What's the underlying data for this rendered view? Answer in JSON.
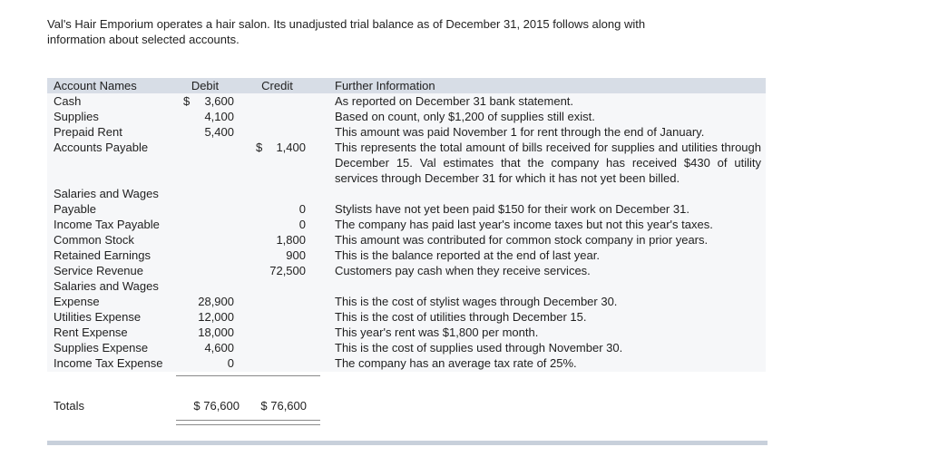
{
  "intro": "Val's Hair Emporium operates a hair salon. Its unadjusted trial balance as of December 31, 2015 follows along with information about selected accounts.",
  "headers": {
    "account": "Account Names",
    "debit": "Debit",
    "credit": "Credit",
    "info": "Further Information"
  },
  "rows": {
    "cash": {
      "name": "Cash",
      "debit_cur": "$",
      "debit": "3,600",
      "info": "As reported on December 31 bank statement."
    },
    "supplies": {
      "name": "Supplies",
      "debit": "4,100",
      "info": "Based on count, only $1,200 of supplies still exist."
    },
    "prepaid": {
      "name": "Prepaid Rent",
      "debit": "5,400",
      "info": "This amount was paid November 1 for rent through the end of January."
    },
    "ap": {
      "name": "Accounts Payable",
      "credit_cur": "$",
      "credit": "1,400",
      "info": "This represents the total amount of bills received for supplies and utilities through December 15. Val estimates that the company has received $430 of utility services through December 31 for which it has not yet been billed."
    },
    "swp": {
      "name1": "Salaries and Wages",
      "name2": "Payable",
      "credit": "0",
      "info": "Stylists have not yet been paid $150 for their work on December 31."
    },
    "itp": {
      "name": "Income Tax Payable",
      "credit": "0",
      "info": "The company has paid last year's income taxes but not this year's taxes."
    },
    "cs": {
      "name": "Common Stock",
      "credit": "1,800",
      "info": "This amount was contributed for common stock company in prior years."
    },
    "re": {
      "name": "Retained Earnings",
      "credit": "900",
      "info": "This is the balance reported at the end of last year."
    },
    "sr": {
      "name": "Service Revenue",
      "credit": "72,500",
      "info": "Customers pay cash when they receive services."
    },
    "swe": {
      "name1": "Salaries and Wages",
      "name2": "Expense",
      "debit": "28,900",
      "info": "This is the cost of stylist wages through December 30."
    },
    "ue": {
      "name": "Utilities Expense",
      "debit": "12,000",
      "info": "This is the cost of utilities through December 15."
    },
    "rent": {
      "name": "Rent Expense",
      "debit": "18,000",
      "info": "This year's rent was $1,800 per month."
    },
    "se": {
      "name": "Supplies Expense",
      "debit": "4,600",
      "info": "This is the cost of supplies used through November 30."
    },
    "ite": {
      "name": "Income Tax Expense",
      "debit": "0",
      "info": "The company has an average tax rate of 25%."
    }
  },
  "totals": {
    "label": "Totals",
    "debit": "$ 76,600",
    "credit": "$ 76,600"
  }
}
